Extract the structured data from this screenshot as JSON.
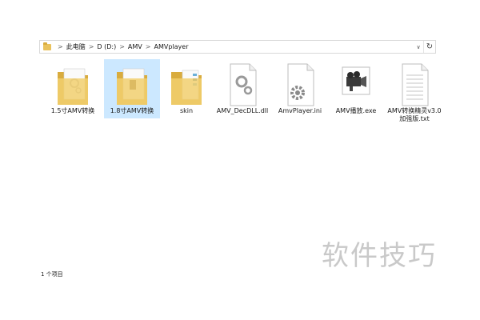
{
  "address_bar": {
    "crumbs": [
      "此电脑",
      "D (D:)",
      "AMV",
      "AMVplayer"
    ],
    "separator": ">",
    "dropdown_glyph": "∨",
    "refresh_glyph": "↻"
  },
  "items": [
    {
      "label": "1.5寸AMV转换",
      "icon": "folder-icon",
      "selected": false
    },
    {
      "label": "1.8寸AMV转换",
      "icon": "folder-icon",
      "selected": true
    },
    {
      "label": "skin",
      "icon": "folder-icon",
      "selected": false
    },
    {
      "label": "AMV_DecDLL.dll",
      "icon": "dll-file-icon",
      "selected": false
    },
    {
      "label": "AmvPlayer.ini",
      "icon": "ini-file-icon",
      "selected": false
    },
    {
      "label": "AMV播放.exe",
      "icon": "camera-exe-icon",
      "selected": false
    },
    {
      "label": "AMV转换精灵v3.0加强版.txt",
      "icon": "text-file-icon",
      "selected": false
    }
  ],
  "status_bar": {
    "text": "1 个项目"
  },
  "watermark": {
    "text": "软件技巧"
  },
  "colors": {
    "selection": "#cce8ff",
    "folder": "#e9c25c",
    "folder_dark": "#d9ac3e"
  }
}
